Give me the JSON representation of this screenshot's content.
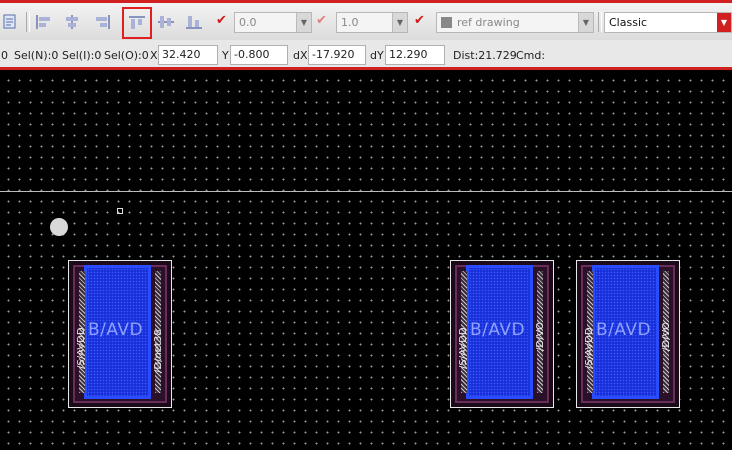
{
  "toolbar": {
    "width_value": "0.0",
    "scale_value": "1.0",
    "layer_value": "ref drawing",
    "style_value": "Classic"
  },
  "status": {
    "sel_count": "0",
    "sel_n": "Sel(N):0",
    "sel_i": "Sel(I):0",
    "sel_o": "Sel(O):0",
    "x_label": "X",
    "x_value": "32.420",
    "y_label": "Y",
    "y_value": "-0.800",
    "dx_label": "dX",
    "dx_value": "-17.920",
    "dy_label": "dY",
    "dy_value": "12.290",
    "dist": "Dist:21.729",
    "cmd": "Cmd:"
  },
  "cells": [
    {
      "left_label": "/S/AVDD",
      "middle_label": "B/AVD",
      "right_label": "/D/net38"
    },
    {
      "left_label": "/S/AVDD",
      "middle_label": "B/AVD",
      "right_label": "/D/VO"
    },
    {
      "left_label": "/S/AVDD",
      "middle_label": "B/AVD",
      "right_label": "/D/VO"
    }
  ],
  "colors": {
    "accent": "#d02020",
    "diffusion": "#1830d8",
    "metal": "#2a4cff"
  }
}
